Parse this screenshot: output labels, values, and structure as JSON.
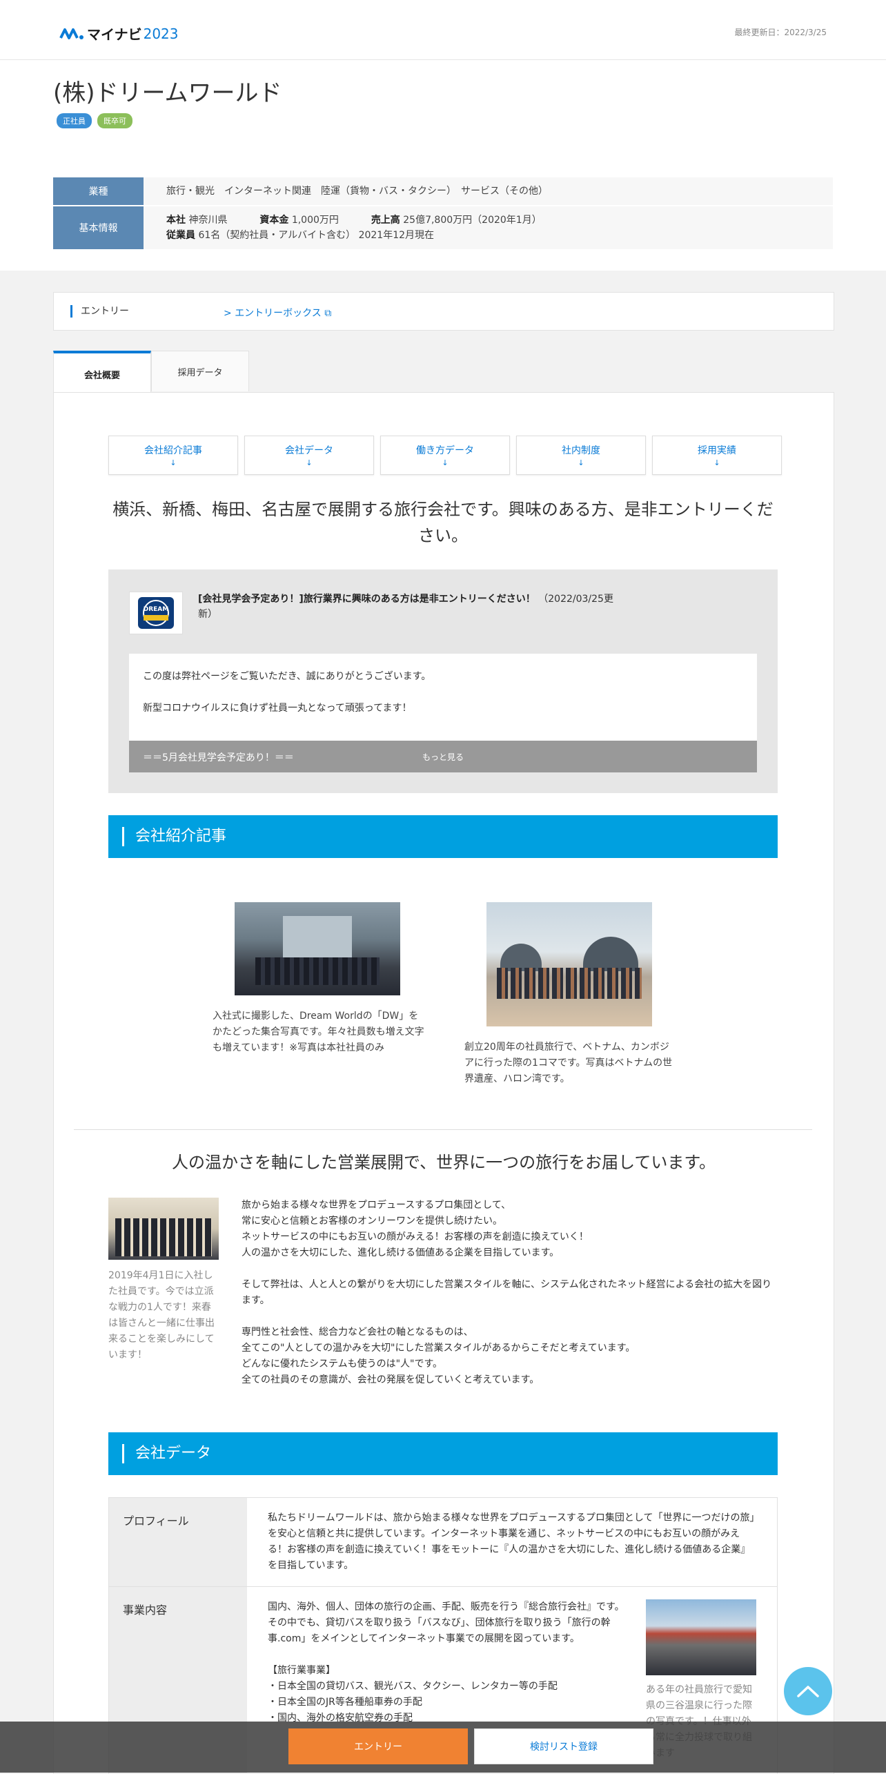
{
  "header": {
    "logo_text": "マイナビ",
    "logo_year": "2023",
    "updated": "最終更新日：2022/3/25"
  },
  "company": {
    "name": "(株)ドリームワールド",
    "tags": [
      "正社員",
      "既卒可"
    ]
  },
  "info": {
    "industry_label": "業種",
    "industry_value": "旅行・観光　インターネット関連　陸運（貨物・バス・タクシー）　サービス（その他）",
    "basic_label": "基本情報",
    "hq_label": "本社",
    "hq_value": "神奈川県",
    "capital_label": "資本金",
    "capital_value": "1,000万円",
    "sales_label": "売上高",
    "sales_value": "25億7,800万円（2020年1月）",
    "employees_label": "従業員",
    "employees_value": "61名（契約社員・アルバイト含む） 2021年12月現在"
  },
  "entry": {
    "label": "エントリー",
    "link": "エントリーボックス"
  },
  "tabs": [
    "会社概要",
    "採用データ"
  ],
  "quicknav": [
    "会社紹介記事",
    "会社データ",
    "働き方データ",
    "社内制度",
    "採用実績"
  ],
  "catchphrase": "横浜、新橋、梅田、名古屋で展開する旅行会社です。興味のある方、是非エントリーください。",
  "news": {
    "logo_text": "DREAM",
    "title": "[会社見学会予定あり！]旅行業界に興味のある方は是非エントリーください！",
    "date": "（2022/03/25更新）",
    "line1": "この度は弊社ページをご覧いただき、誠にありがとうございます。",
    "line2": "新型コロナウイルスに負けず社員一丸となって頑張ってます！",
    "line3": "＝＝5月会社見学会予定あり！＝＝",
    "more": "もっと見る"
  },
  "section_intro": "会社紹介記事",
  "photos": {
    "cap1": "入社式に撮影した、Dream Worldの「DW」をかたどった集合写真です。年々社員数も増え文字も増えています！※写真は本社社員のみ",
    "cap2": "創立20周年の社員旅行で、ベトナム、カンボジアに行った際の1コマです。写真はベトナムの世界遺産、ハロン湾です。"
  },
  "article": {
    "heading": "人の温かさを軸にした営業展開で、世界に一つの旅行をお届しています。",
    "side_caption": "2019年4月1日に入社した社員です。今では立派な戦力の1人です！来春は皆さんと一緒に仕事出来ることを楽しみにしています！",
    "p1": "旅から始まる様々な世界をプロデュースするプロ集団として、",
    "p2": "常に安心と信頼とお客様のオンリーワンを提供し続けたい。",
    "p3": "ネットサービスの中にもお互いの顔がみえる！お客様の声を創造に換えていく！",
    "p4": "人の温かさを大切にした、進化し続ける価値ある企業を目指しています。",
    "p5": "そして弊社は、人と人との繋がりを大切にした営業スタイルを軸に、システム化されたネット経営による会社の拡大を図ります。",
    "p6": "専門性と社会性、総合力など会社の軸となるものは、",
    "p7": "全てこの\"人としての温かみを大切\"にした営業スタイルがあるからこそだと考えています。",
    "p8": "どんなに優れたシステムも使うのは\"人\"です。",
    "p9": "全ての社員のその意識が、会社の発展を促していくと考えています。"
  },
  "section_data": "会社データ",
  "data_table": {
    "profile_label": "プロフィール",
    "profile_value": "私たちドリームワールドは、旅から始まる様々な世界をプロデュースするプロ集団として「世界に一つだけの旅」を安心と信頼と共に提供しています。インターネット事業を通じ、ネットサービスの中にもお互いの顔がみえる！お客様の声を創造に換えていく！事をモットーに『人の温かさを大切にした、進化し続ける価値ある企業』を目指しています。",
    "business_label": "事業内容",
    "business_value": "国内、海外、個人、団体の旅行の企画、手配、販売を行う『総合旅行会社』です。その中でも、貸切バスを取り扱う「バスなび」、団体旅行を取り扱う「旅行の幹事.com」をメインとしてインターネット事業での展開を図っています。",
    "travel_heading": "【旅行業事業】",
    "travel1": "・日本全国の貸切バス、観光バス、タクシー、レンタカー等の手配",
    "travel2": "・日本全国のJR等各種船車券の手配",
    "travel3": "・国内、海外の格安航空券の手配",
    "business_photo_caption": "ある年の社員旅行で愛知県の三谷温泉に行った際の写真です。！仕事以外も常に全力投球で取り組みます"
  },
  "bottom": {
    "entry": "エントリー",
    "list": "検討リスト登録"
  }
}
